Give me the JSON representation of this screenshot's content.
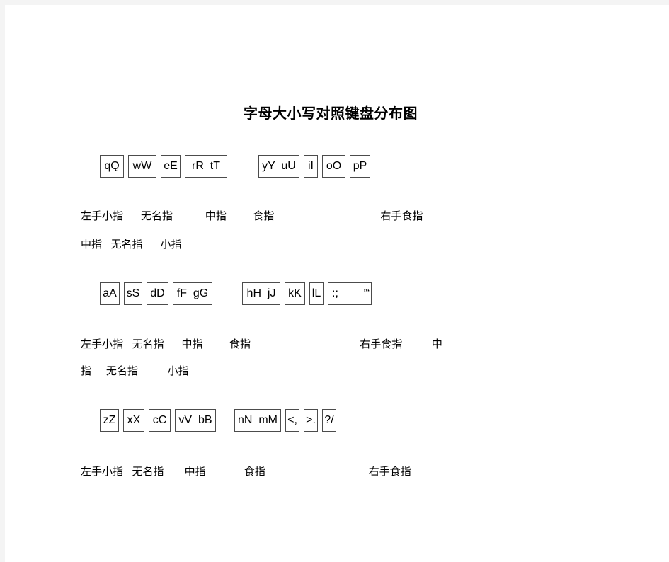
{
  "document": {
    "title": "字母大小写对照键盘分布图",
    "page_background": "#ffffff",
    "canvas_background": "#f4f4f4",
    "key_border_color": "#4c4c4c",
    "text_color": "#000000"
  },
  "keyboard": {
    "rows": [
      {
        "name": "top-row",
        "left_keys": [
          "qQ",
          "wW",
          "eE",
          "rR  tT"
        ],
        "right_keys": [
          "yY  uU",
          "iI",
          "oO",
          "pP"
        ]
      },
      {
        "name": "home-row",
        "left_keys": [
          "aA",
          "sS",
          "dD",
          "fF  gG"
        ],
        "right_keys": [
          "hH  jJ",
          "kK",
          "lL",
          ":;        ”‘"
        ]
      },
      {
        "name": "bottom-row",
        "left_keys": [
          "zZ",
          "xX",
          "cC",
          "vV  bB"
        ],
        "right_keys": [
          "nN  mM",
          "<,",
          ">.",
          "?/"
        ]
      }
    ]
  },
  "finger_labels": {
    "row1_line1": "左手小指      无名指           中指         食指                                    右手食指",
    "row1_line2": "中指   无名指      小指",
    "row2_line1": "左手小指   无名指      中指         食指                                     右手食指          中",
    "row2_line2": "指     无名指          小指",
    "row3_line1": "左手小指   无名指       中指             食指                                   右手食指"
  }
}
